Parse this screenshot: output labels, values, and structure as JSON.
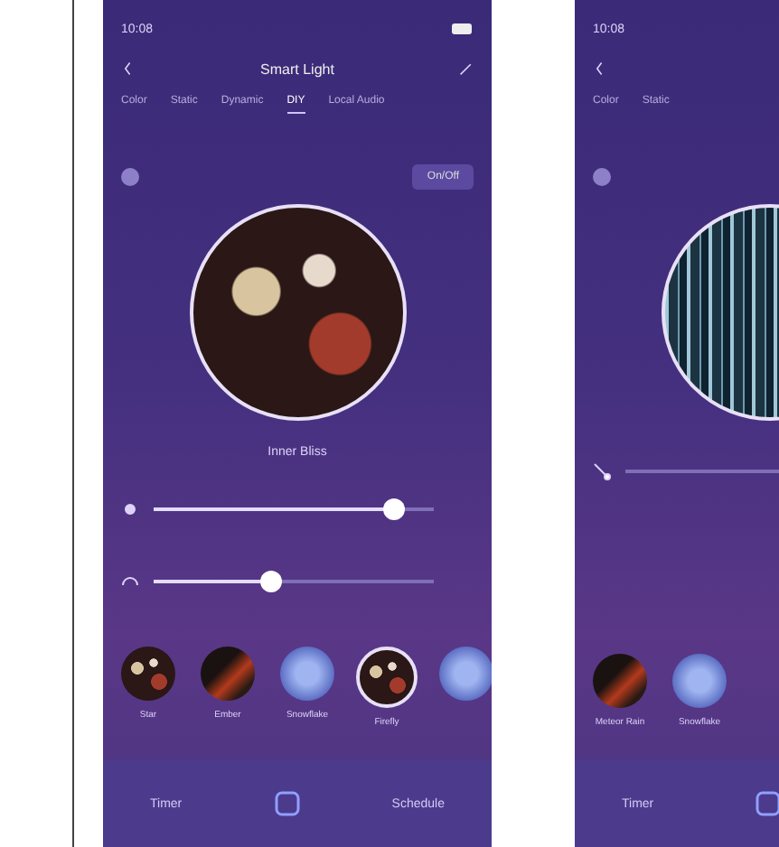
{
  "phones": [
    {
      "time": "10:08",
      "title": "Smart Light",
      "tabs": [
        {
          "label": "Color",
          "selected": false
        },
        {
          "label": "Static",
          "selected": false
        },
        {
          "label": "Dynamic",
          "selected": false
        },
        {
          "label": "DIY",
          "selected": true
        },
        {
          "label": "Local Audio",
          "selected": false
        }
      ],
      "switch_label": "On/Off",
      "kind": "bokeh",
      "scene": "Inner Bliss",
      "sliders": [
        {
          "kind": "brightness",
          "level": 0.86
        },
        {
          "kind": "speed",
          "level": 0.42
        }
      ],
      "effects": [
        {
          "label": "Star",
          "kind": "bokeh",
          "selected": false
        },
        {
          "label": "Ember",
          "kind": "ember",
          "selected": false
        },
        {
          "label": "Snowflake",
          "kind": "snow",
          "selected": false
        },
        {
          "label": "Firefly",
          "kind": "bokeh",
          "selected": true
        },
        {
          "kind": "snow",
          "selected": false
        }
      ],
      "nav": [
        "Timer",
        "Schedule"
      ]
    },
    {
      "time": "10:08",
      "tabs": [
        {
          "label": "Color",
          "selected": false
        },
        {
          "label": "Static",
          "selected": false
        }
      ],
      "kind": "rain",
      "sliders": [
        {
          "kind": "wand"
        }
      ],
      "effects": [
        {
          "label": "Meteor Rain",
          "kind": "ember",
          "selected": false
        },
        {
          "label": "Snowflake",
          "kind": "snow",
          "selected": false
        }
      ],
      "nav": [
        "Timer"
      ]
    }
  ]
}
